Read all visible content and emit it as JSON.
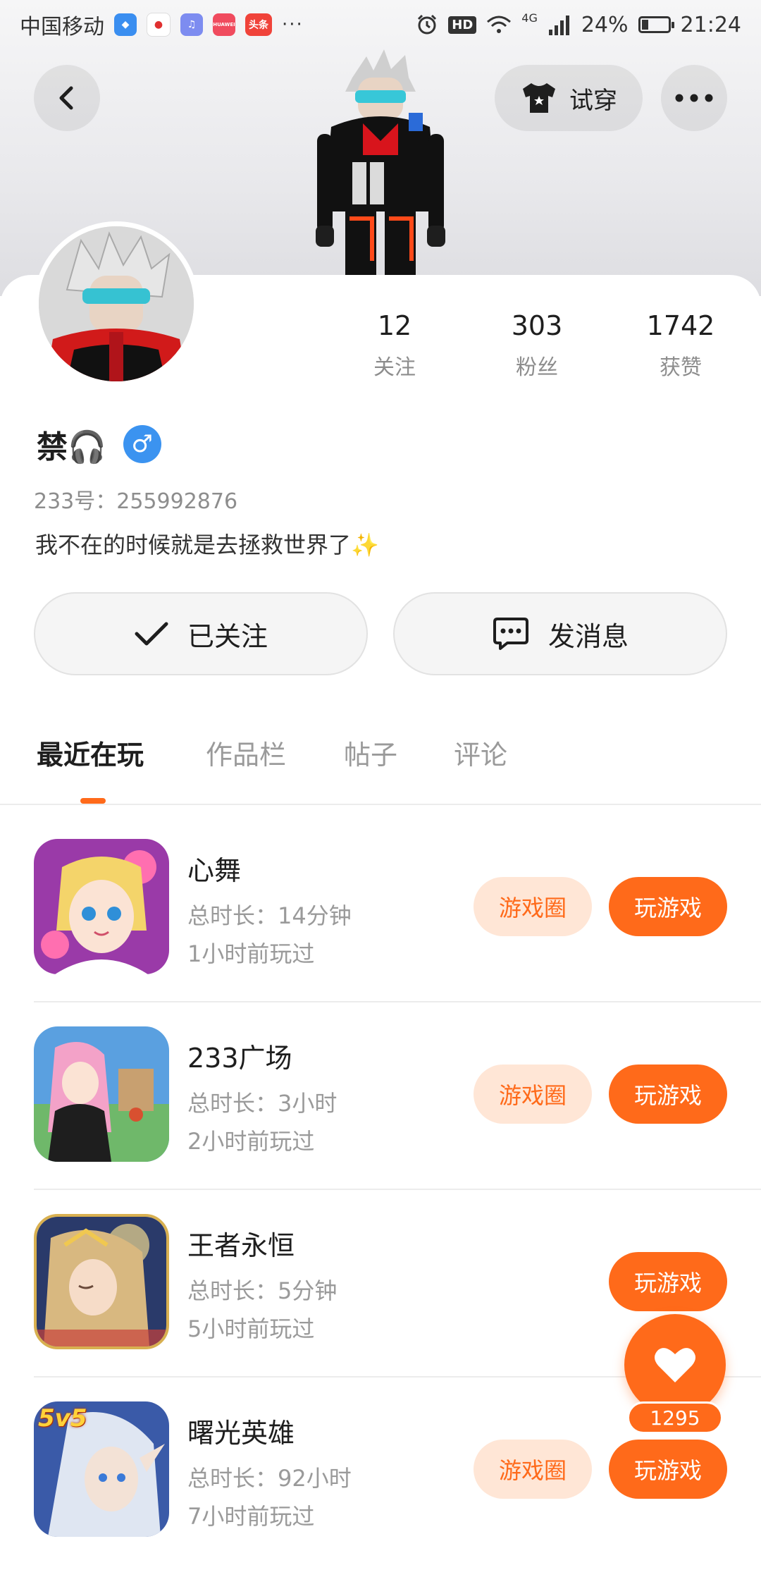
{
  "status_bar": {
    "carrier": "中国移动",
    "apps": [
      "shield-app",
      "baidu-map-app",
      "music-app",
      "huawei-app",
      "toutiao-app"
    ],
    "huawei_label": "HUAWEI",
    "toutiao_label": "头条",
    "more": "···",
    "hd": "HD",
    "network": "4G",
    "battery_percent": "24%",
    "battery_level": 0.24,
    "time": "21:24"
  },
  "header": {
    "back_icon": "chevron-left-icon",
    "try_on_label": "试穿",
    "more_icon": "more-horizontal-icon"
  },
  "profile": {
    "stats": [
      {
        "value": "12",
        "label": "关注"
      },
      {
        "value": "303",
        "label": "粉丝"
      },
      {
        "value": "1742",
        "label": "获赞"
      }
    ],
    "name": "禁🎧",
    "gender_symbol": "♂",
    "uid_text": "233号：255992876",
    "bio": "我不在的时候就是去拯救世界了✨",
    "follow_button": "已关注",
    "message_button": "发消息"
  },
  "tabs": [
    {
      "label": "最近在玩",
      "active": true
    },
    {
      "label": "作品栏",
      "active": false
    },
    {
      "label": "帖子",
      "active": false
    },
    {
      "label": "评论",
      "active": false
    }
  ],
  "games": [
    {
      "name": "心舞",
      "duration": "总时长：14分钟",
      "last_played": "1小时前玩过",
      "circle_label": "游戏圈",
      "has_circle": true,
      "play_label": "玩游戏"
    },
    {
      "name": "233广场",
      "duration": "总时长：3小时",
      "last_played": "2小时前玩过",
      "circle_label": "游戏圈",
      "has_circle": true,
      "play_label": "玩游戏"
    },
    {
      "name": "王者永恒",
      "duration": "总时长：5分钟",
      "last_played": "5小时前玩过",
      "circle_label": "",
      "has_circle": false,
      "play_label": "玩游戏"
    },
    {
      "name": "曙光英雄",
      "duration": "总时长：92小时",
      "last_played": "7小时前玩过",
      "circle_label": "游戏圈",
      "has_circle": true,
      "play_label": "玩游戏",
      "icon_badge": "5v5"
    }
  ],
  "like": {
    "count": "1295",
    "icon": "heart-icon"
  },
  "colors": {
    "accent": "#ff6a1a",
    "accent_light": "#ffe6d6",
    "gender_blue": "#3b93f0",
    "text_primary": "#1e1e1e",
    "text_secondary": "#9a9a9a"
  }
}
